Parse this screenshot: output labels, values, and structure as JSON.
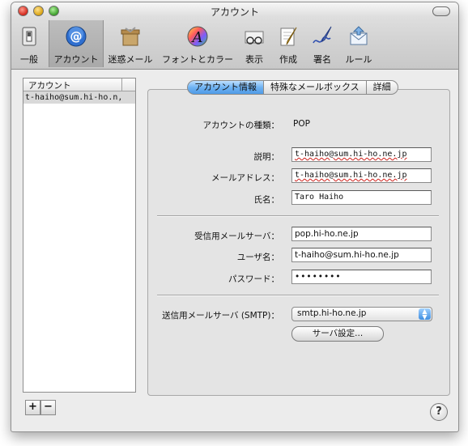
{
  "window": {
    "title": "アカウント"
  },
  "toolbar": {
    "items": [
      {
        "label": "一般",
        "icon": "light-switch-icon"
      },
      {
        "label": "アカウント",
        "icon": "at-sign-icon",
        "selected": true
      },
      {
        "label": "迷惑メール",
        "icon": "junk-mail-icon"
      },
      {
        "label": "フォントとカラー",
        "icon": "font-color-icon"
      },
      {
        "label": "表示",
        "icon": "glasses-icon"
      },
      {
        "label": "作成",
        "icon": "compose-pencil-icon"
      },
      {
        "label": "署名",
        "icon": "signature-pen-icon"
      },
      {
        "label": "ルール",
        "icon": "rules-envelope-icon"
      }
    ]
  },
  "account_list": {
    "header": "アカウント",
    "items": [
      "t-haiho@sum.hi-ho.n,"
    ]
  },
  "list_buttons": {
    "add": "+",
    "remove": "−"
  },
  "tabs": [
    {
      "label": "アカウント情報",
      "selected": true
    },
    {
      "label": "特殊なメールボックス",
      "selected": false
    },
    {
      "label": "詳細",
      "selected": false
    }
  ],
  "form": {
    "account_type_label": "アカウントの種類：",
    "account_type_value": "POP",
    "description_label": "説明：",
    "description_value": "t-haiho@sum.hi-ho.ne.jp",
    "email_label": "メールアドレス：",
    "email_value": "t-haiho@sum.hi-ho.ne.jp",
    "name_label": "氏名：",
    "name_value": "Taro Haiho",
    "incoming_label": "受信用メールサーバ：",
    "incoming_value": "pop.hi-ho.ne.jp",
    "username_label": "ユーザ名：",
    "username_value": "t-haiho@sum.hi-ho.ne.jp",
    "password_label": "パスワード：",
    "password_value": "••••••••",
    "smtp_label": "送信用メールサーバ (SMTP)：",
    "smtp_value": "smtp.hi-ho.ne.jp",
    "server_settings_button": "サーバ設定..."
  },
  "help": "?",
  "colors": {
    "selected_tab": "#5aa3ec",
    "spelling_underline": "#d0201a"
  }
}
